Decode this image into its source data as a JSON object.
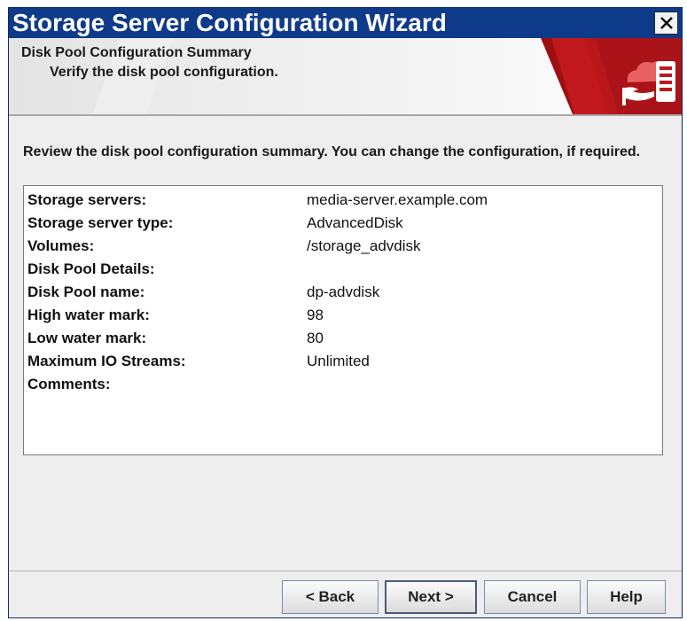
{
  "window": {
    "title": "Storage Server Configuration Wizard",
    "close_glyph": "✕"
  },
  "header": {
    "title": "Disk Pool Configuration Summary",
    "subtitle": "Verify the disk pool configuration.",
    "brand_icon": "storage-cloud-logo-icon",
    "brand_color": "#c0181c"
  },
  "main": {
    "intro": "Review the disk pool configuration summary. You can change the configuration, if required.",
    "summary": [
      {
        "label": "Storage servers:",
        "value": "media-server.example.com"
      },
      {
        "label": "Storage server type:",
        "value": "AdvancedDisk"
      },
      {
        "label": "Volumes:",
        "value": "/storage_advdisk"
      },
      {
        "label": "Disk Pool Details:",
        "value": ""
      },
      {
        "label": "Disk Pool name:",
        "value": "dp-advdisk"
      },
      {
        "label": "High water mark:",
        "value": "98"
      },
      {
        "label": "Low water mark:",
        "value": "80"
      },
      {
        "label": "Maximum IO Streams:",
        "value": "Unlimited"
      },
      {
        "label": "Comments:",
        "value": ""
      }
    ]
  },
  "footer": {
    "back_label": "< Back",
    "next_label": "Next >",
    "cancel_label": "Cancel",
    "help_label": "Help"
  }
}
